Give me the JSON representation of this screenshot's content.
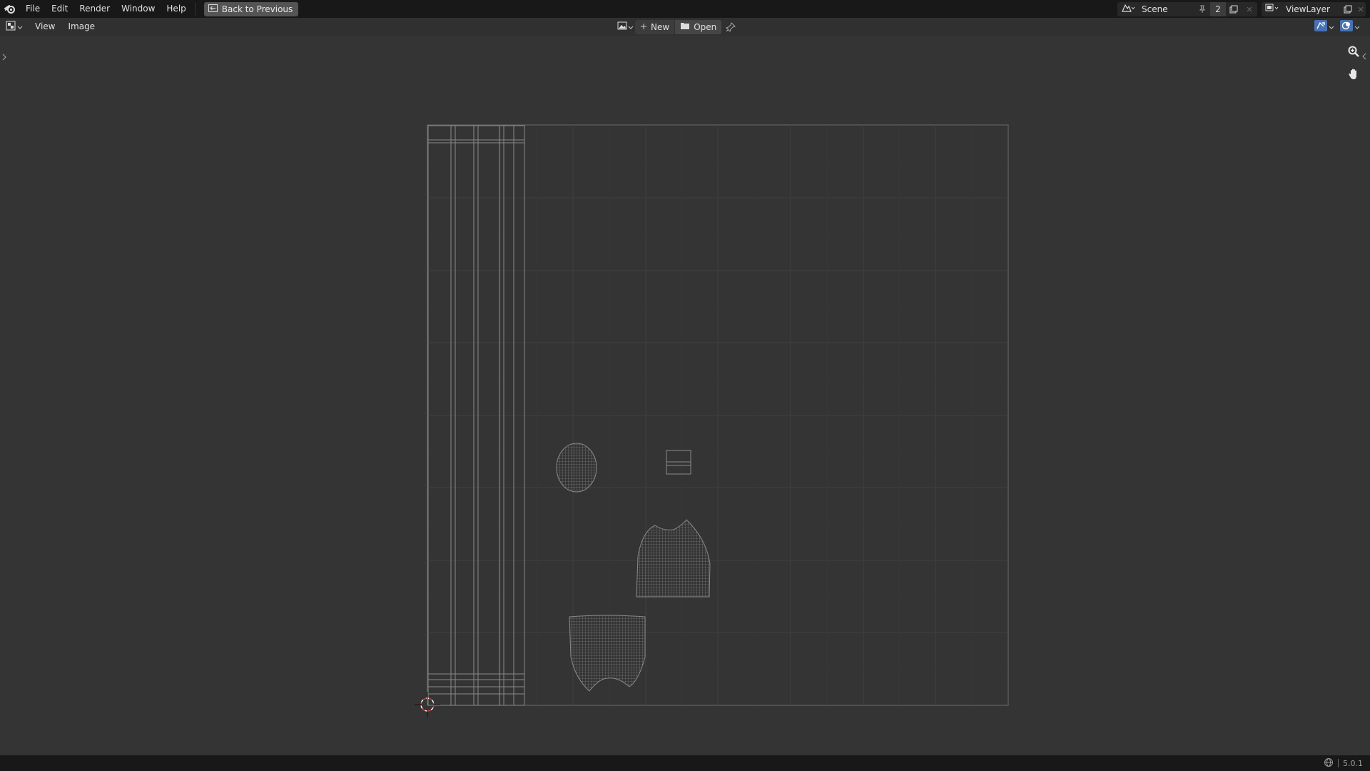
{
  "menu": {
    "items": [
      "File",
      "Edit",
      "Render",
      "Window",
      "Help"
    ],
    "back_button": "Back to Previous"
  },
  "scene": {
    "name": "Scene",
    "users": "2",
    "view_layer": "ViewLayer"
  },
  "editor_header": {
    "menus": [
      "View",
      "Image"
    ],
    "new_label": "New",
    "open_label": "Open"
  },
  "status": {
    "version": "5.0.1"
  },
  "colors": {
    "background": "#343434",
    "top_bar": "#181818",
    "header": "#303030",
    "uv_wire": "#7a7a7a",
    "cursor_red": "#d04040"
  },
  "icons": [
    "blender-logo",
    "back-icon",
    "scene-icon",
    "pin-icon",
    "new-scene-icon",
    "remove-icon",
    "view-layer-icon",
    "image-editor-icon",
    "image-browse-icon",
    "plus-icon",
    "folder-icon",
    "uv-sync-icon",
    "overlay-icon",
    "zoom-icon",
    "hand-pan-icon",
    "globe-icon"
  ]
}
